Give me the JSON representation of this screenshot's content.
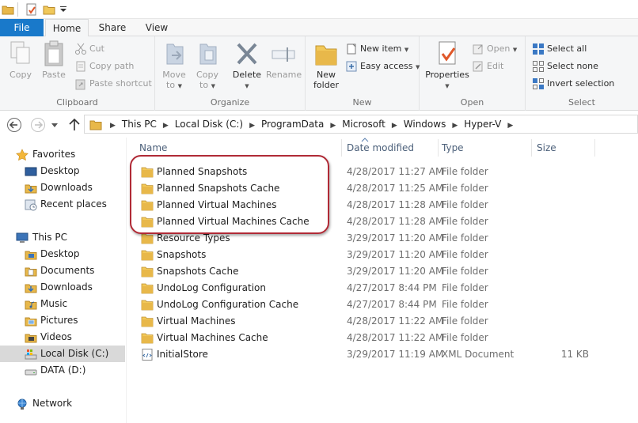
{
  "ribbon": {
    "tabs": {
      "file": "File",
      "home": "Home",
      "share": "Share",
      "view": "View"
    },
    "clipboard": {
      "label": "Clipboard",
      "copy": "Copy",
      "paste": "Paste",
      "cut": "Cut",
      "copy_path": "Copy path",
      "paste_shortcut": "Paste shortcut"
    },
    "organize": {
      "label": "Organize",
      "move_to_1": "Move",
      "move_to_2": "to",
      "copy_to_1": "Copy",
      "copy_to_2": "to",
      "delete": "Delete",
      "rename": "Rename"
    },
    "new": {
      "label": "New",
      "new_folder_1": "New",
      "new_folder_2": "folder",
      "new_item": "New item",
      "easy_access": "Easy access"
    },
    "open": {
      "label": "Open",
      "properties": "Properties",
      "open": "Open",
      "edit": "Edit"
    },
    "select": {
      "label": "Select",
      "select_all": "Select all",
      "select_none": "Select none",
      "invert_selection": "Invert selection"
    }
  },
  "address": {
    "crumbs": [
      "This PC",
      "Local Disk (C:)",
      "ProgramData",
      "Microsoft",
      "Windows",
      "Hyper-V"
    ]
  },
  "nav_pane": {
    "favorites": {
      "label": "Favorites",
      "items": [
        "Desktop",
        "Downloads",
        "Recent places"
      ]
    },
    "this_pc": {
      "label": "This PC",
      "items": [
        "Desktop",
        "Documents",
        "Downloads",
        "Music",
        "Pictures",
        "Videos",
        "Local Disk (C:)",
        "DATA (D:)"
      ]
    },
    "network": "Network"
  },
  "columns": {
    "name": "Name",
    "date": "Date modified",
    "type": "Type",
    "size": "Size"
  },
  "files": [
    {
      "name": "Planned Snapshots",
      "date": "4/28/2017 11:27 AM",
      "type": "File folder",
      "size": "",
      "kind": "folder"
    },
    {
      "name": "Planned Snapshots Cache",
      "date": "4/28/2017 11:25 AM",
      "type": "File folder",
      "size": "",
      "kind": "folder"
    },
    {
      "name": "Planned Virtual Machines",
      "date": "4/28/2017 11:28 AM",
      "type": "File folder",
      "size": "",
      "kind": "folder"
    },
    {
      "name": "Planned Virtual Machines Cache",
      "date": "4/28/2017 11:28 AM",
      "type": "File folder",
      "size": "",
      "kind": "folder"
    },
    {
      "name": "Resource Types",
      "date": "3/29/2017 11:20 AM",
      "type": "File folder",
      "size": "",
      "kind": "folder"
    },
    {
      "name": "Snapshots",
      "date": "3/29/2017 11:20 AM",
      "type": "File folder",
      "size": "",
      "kind": "folder"
    },
    {
      "name": "Snapshots Cache",
      "date": "3/29/2017 11:20 AM",
      "type": "File folder",
      "size": "",
      "kind": "folder"
    },
    {
      "name": "UndoLog Configuration",
      "date": "4/27/2017 8:44 PM",
      "type": "File folder",
      "size": "",
      "kind": "folder"
    },
    {
      "name": "UndoLog Configuration Cache",
      "date": "4/27/2017 8:44 PM",
      "type": "File folder",
      "size": "",
      "kind": "folder"
    },
    {
      "name": "Virtual Machines",
      "date": "4/28/2017 11:22 AM",
      "type": "File folder",
      "size": "",
      "kind": "folder"
    },
    {
      "name": "Virtual Machines Cache",
      "date": "4/28/2017 11:22 AM",
      "type": "File folder",
      "size": "",
      "kind": "folder"
    },
    {
      "name": "InitialStore",
      "date": "3/29/2017 11:19 AM",
      "type": "XML Document",
      "size": "11 KB",
      "kind": "xml"
    }
  ],
  "colors": {
    "file_tab": "#1979ca",
    "highlight": "#b02a36",
    "header_text": "#4c607a",
    "folder": "#e8b84a"
  }
}
